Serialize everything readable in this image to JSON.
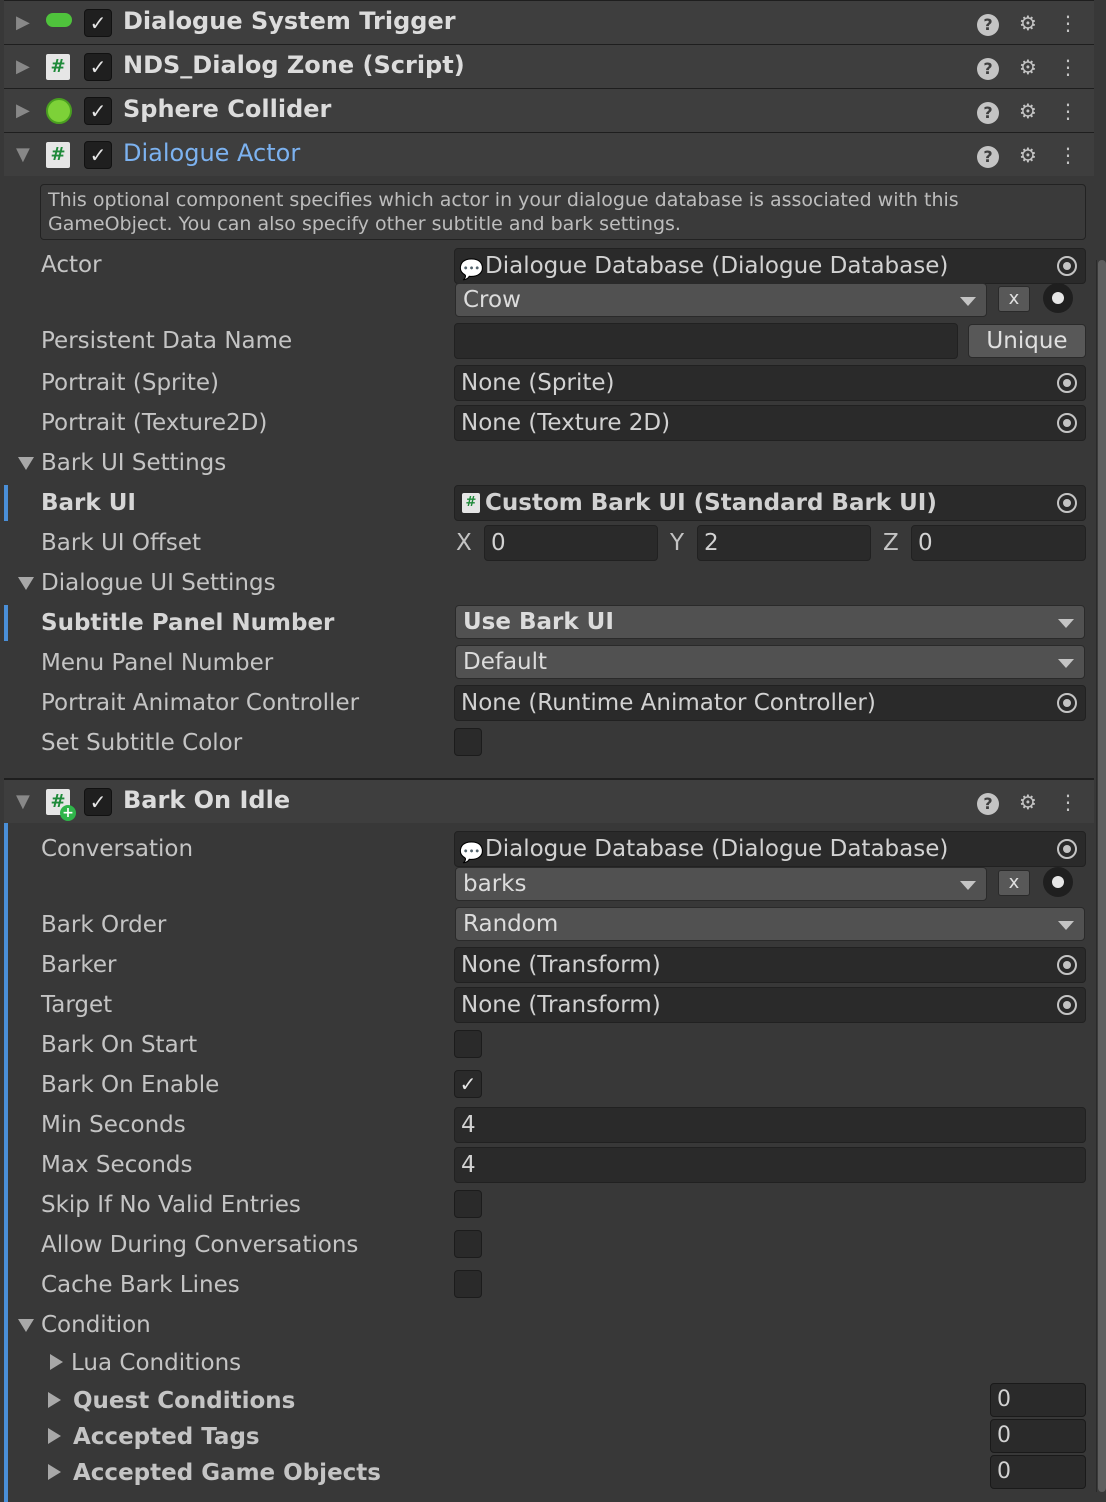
{
  "components": [
    {
      "title": "Dialogue System Trigger",
      "icon": "green-pill-icon",
      "enabled": true,
      "expanded": false
    },
    {
      "title": "NDS_Dialog Zone (Script)",
      "icon": "script-icon",
      "enabled": true,
      "expanded": false
    },
    {
      "title": "Sphere Collider",
      "icon": "sphere-collider-icon",
      "enabled": true,
      "expanded": false
    },
    {
      "title": "Dialogue Actor",
      "icon": "script-icon",
      "enabled": true,
      "expanded": true
    },
    {
      "title": "Bark On Idle",
      "icon": "script-add-icon",
      "enabled": true,
      "expanded": true
    }
  ],
  "dialogue_actor": {
    "help_text": "This optional component specifies which actor in your dialogue database is associated with this GameObject. You can also specify other subtitle and bark settings.",
    "actor_label": "Actor",
    "actor_database": "Dialogue Database (Dialogue Database)",
    "actor_value": "Crow",
    "x_label": "x",
    "persistent_label": "Persistent Data Name",
    "persistent_value": "",
    "unique_label": "Unique",
    "portrait_sprite_label": "Portrait (Sprite)",
    "portrait_sprite_value": "None (Sprite)",
    "portrait_tex_label": "Portrait (Texture2D)",
    "portrait_tex_value": "None (Texture 2D)",
    "bark_ui_settings_label": "Bark UI Settings",
    "bark_ui_label": "Bark UI",
    "bark_ui_value": "Custom Bark UI (Standard Bark UI)",
    "bark_ui_offset_label": "Bark UI Offset",
    "offset": {
      "x_label": "X",
      "x": "0",
      "y_label": "Y",
      "y": "2",
      "z_label": "Z",
      "z": "0"
    },
    "dialogue_ui_settings_label": "Dialogue UI Settings",
    "subtitle_panel_label": "Subtitle Panel Number",
    "subtitle_panel_value": "Use Bark UI",
    "menu_panel_label": "Menu Panel Number",
    "menu_panel_value": "Default",
    "portrait_anim_label": "Portrait Animator Controller",
    "portrait_anim_value": "None (Runtime Animator Controller)",
    "set_subtitle_color_label": "Set Subtitle Color",
    "set_subtitle_color": false
  },
  "bark_on_idle": {
    "conversation_label": "Conversation",
    "conversation_database": "Dialogue Database (Dialogue Database)",
    "conversation_value": "barks",
    "x_label": "x",
    "bark_order_label": "Bark Order",
    "bark_order_value": "Random",
    "barker_label": "Barker",
    "barker_value": "None (Transform)",
    "target_label": "Target",
    "target_value": "None (Transform)",
    "bark_on_start_label": "Bark On Start",
    "bark_on_start": false,
    "bark_on_enable_label": "Bark On Enable",
    "bark_on_enable": true,
    "min_seconds_label": "Min Seconds",
    "min_seconds": "4",
    "max_seconds_label": "Max Seconds",
    "max_seconds": "4",
    "skip_label": "Skip If No Valid Entries",
    "skip": false,
    "allow_label": "Allow During Conversations",
    "allow": false,
    "cache_label": "Cache Bark Lines",
    "cache": false,
    "condition_label": "Condition",
    "lua_label": "Lua Conditions",
    "quest_label": "Quest Conditions",
    "quest_count": "0",
    "tags_label": "Accepted Tags",
    "tags_count": "0",
    "gameobjects_label": "Accepted Game Objects",
    "gameobjects_count": "0"
  },
  "colors": {
    "background": "#383838",
    "header": "#3e3e3e",
    "accent_blue": "#7cb2f0",
    "field": "#2a2a2a"
  }
}
